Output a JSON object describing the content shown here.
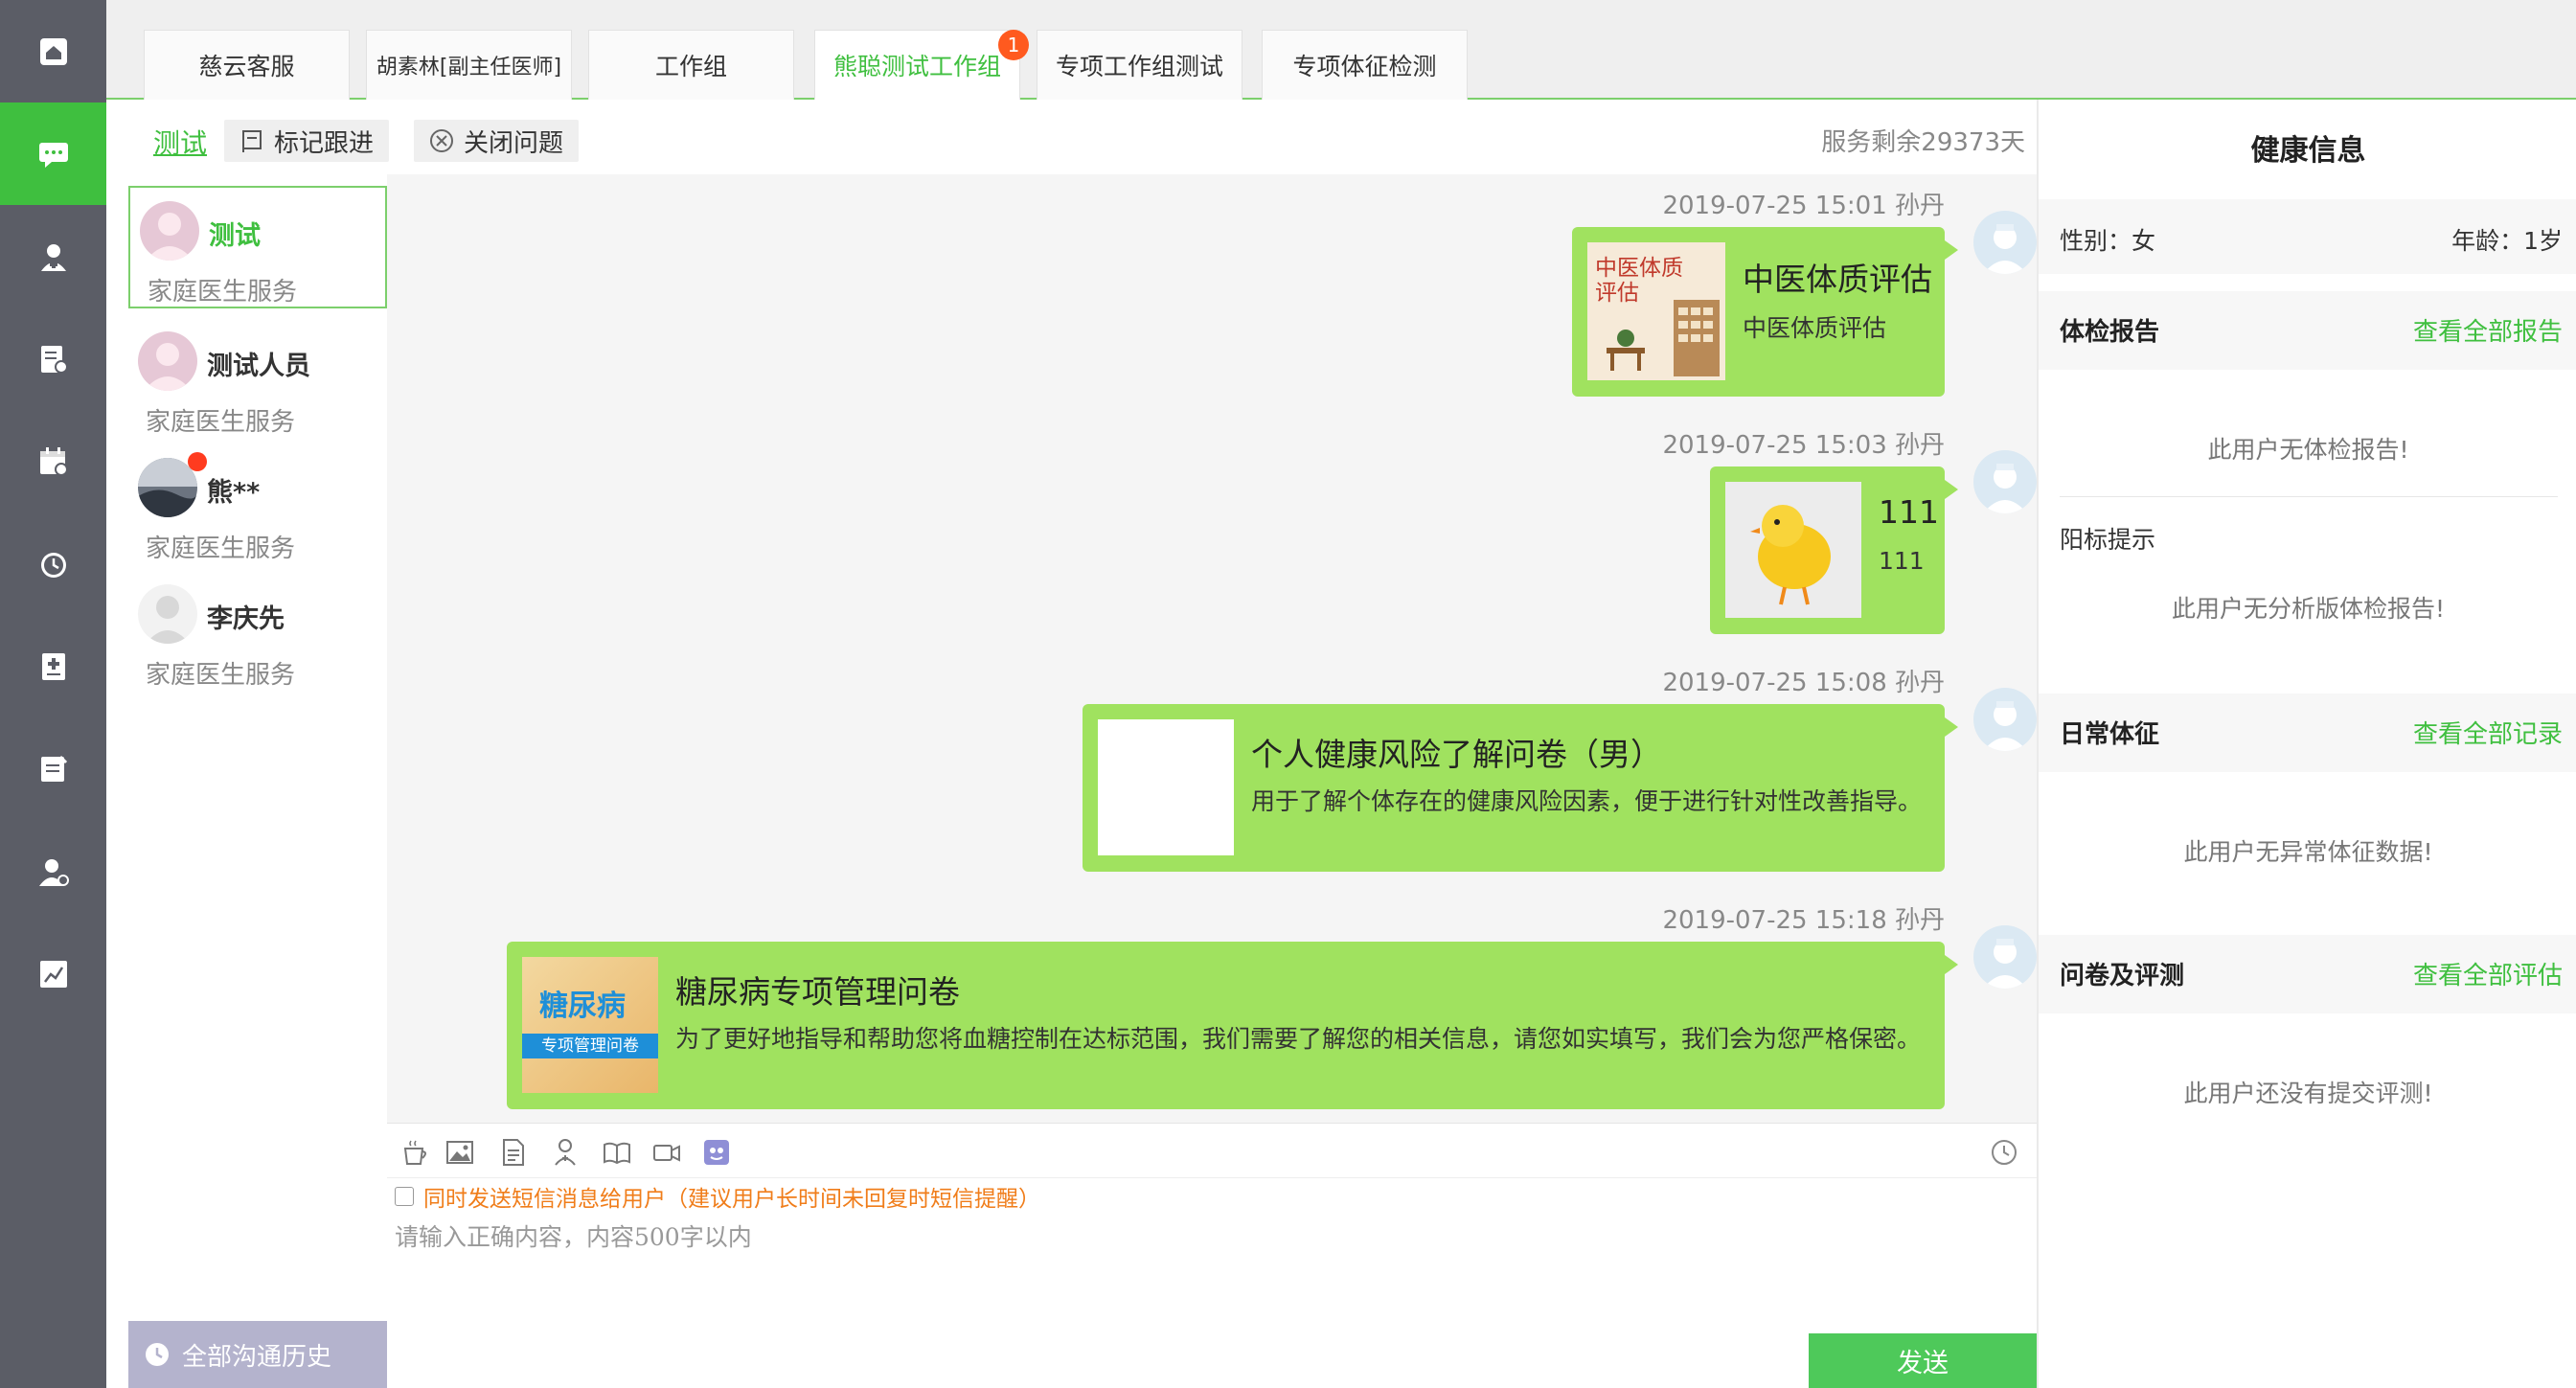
{
  "rail": {
    "items": [
      {
        "icon": "home-icon"
      },
      {
        "icon": "chat-icon",
        "active": true
      },
      {
        "icon": "doctor-icon"
      },
      {
        "icon": "report-icon"
      },
      {
        "icon": "calendar-icon"
      },
      {
        "icon": "alarm-icon"
      },
      {
        "icon": "medical-record-icon"
      },
      {
        "icon": "checklist-icon"
      },
      {
        "icon": "user-settings-icon"
      },
      {
        "icon": "stats-icon"
      }
    ]
  },
  "tabs": [
    {
      "label": "慈云客服"
    },
    {
      "label": "胡素林[副主任医师]"
    },
    {
      "label": "工作组"
    },
    {
      "label": "熊聪测试工作组",
      "badge": "1",
      "active": true
    },
    {
      "label": "专项工作组测试"
    },
    {
      "label": "专项体征检测"
    }
  ],
  "subbar": {
    "current_name": "测试",
    "mark_follow": "标记跟进",
    "close_issue": "关闭问题",
    "service_left": "服务剩余29373天"
  },
  "patients": [
    {
      "name": "测试",
      "service": "家庭医生服务"
    },
    {
      "name": "测试人员",
      "service": "家庭医生服务"
    },
    {
      "name": "熊**",
      "service": "家庭医生服务"
    },
    {
      "name": "李庆先",
      "service": "家庭医生服务"
    }
  ],
  "history_button": "全部沟通历史",
  "messages": [
    {
      "time": "2019-07-25 15:01 孙丹",
      "title": "中医体质评估",
      "desc": "中医体质评估",
      "thumb_text_1": "中医体质",
      "thumb_text_2": "评估"
    },
    {
      "time": "2019-07-25 15:03 孙丹",
      "title": "111",
      "desc": "111"
    },
    {
      "time": "2019-07-25 15:08 孙丹",
      "title": "个人健康风险了解问卷（男）",
      "desc": "用于了解个体存在的健康风险因素，便于进行针对性改善指导。"
    },
    {
      "time": "2019-07-25 15:18 孙丹",
      "title": "糖尿病专项管理问卷",
      "desc": "为了更好地指导和帮助您将血糖控制在达标范围，我们需要了解您的相关信息，请您如实填写，我们会为您严格保密。",
      "thumb_text_1": "糖尿病",
      "thumb_text_2": "专项管理问卷"
    }
  ],
  "toolbar": {
    "icons": [
      "tea-icon",
      "image-icon",
      "document-icon",
      "stethoscope-icon",
      "book-icon",
      "video-icon",
      "ai-assistant-icon"
    ],
    "history_icon": "clock-icon"
  },
  "sms": {
    "label": "同时发送短信消息给用户（建议用户长时间未回复时短信提醒）"
  },
  "input": {
    "placeholder": "请输入正确内容，内容500字以内"
  },
  "send_label": "发送",
  "health": {
    "title": "健康信息",
    "gender": "性别：女",
    "age": "年龄：1岁",
    "checkup_header": "体检报告",
    "checkup_link": "查看全部报告",
    "checkup_empty": "此用户无体检报告!",
    "positive_header": "阳标提示",
    "positive_empty": "此用户无分析版体检报告!",
    "vitals_header": "日常体征",
    "vitals_link": "查看全部记录",
    "vitals_empty": "此用户无异常体征数据!",
    "survey_header": "问卷及评测",
    "survey_link": "查看全部评估",
    "survey_empty": "此用户还没有提交评测!"
  },
  "colors": {
    "accent": "#3fbf3f",
    "bubble": "#a0e25f",
    "rail": "#5b5d66",
    "badge": "#ff5a1f",
    "warning": "#f07d1a"
  }
}
